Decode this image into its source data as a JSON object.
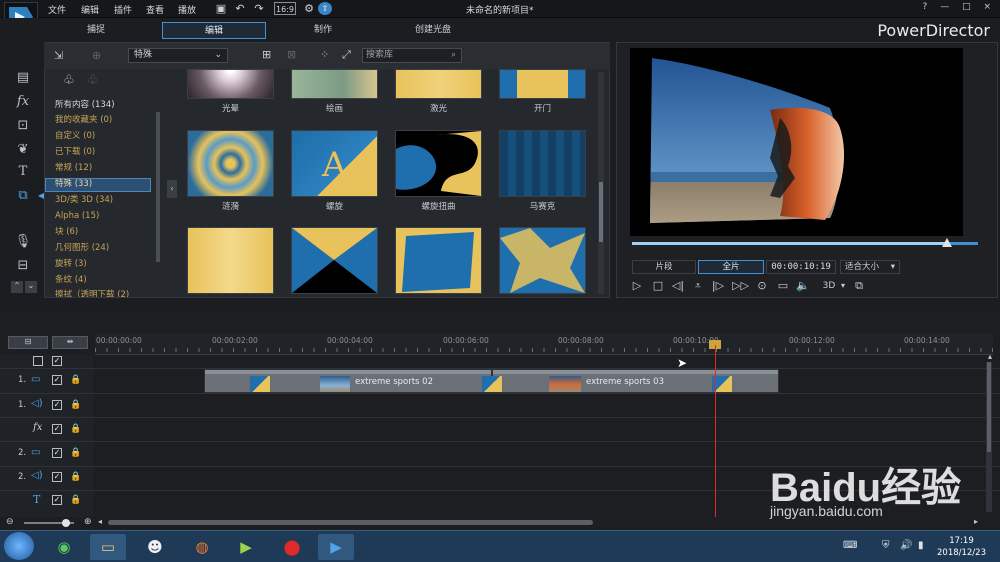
{
  "menu": [
    "文件",
    "编辑",
    "插件",
    "查看",
    "播放"
  ],
  "window_title": "未命名的新项目*",
  "window_buttons": [
    "?",
    "—",
    "□",
    "×"
  ],
  "tabs": [
    {
      "label": "捕捉",
      "active": false
    },
    {
      "label": "编辑",
      "active": true
    },
    {
      "label": "制作",
      "active": false
    },
    {
      "label": "创建光盘",
      "active": false
    }
  ],
  "brand": "PowerDirector",
  "library": {
    "category_dropdown": "特殊",
    "search_placeholder": "搜索库",
    "categories": [
      {
        "label": "所有内容 (134)",
        "selected": false
      },
      {
        "label": "我的收藏夹 (0)",
        "selected": false
      },
      {
        "label": "自定义 (0)",
        "selected": false
      },
      {
        "label": "已下载 (0)",
        "selected": false
      },
      {
        "label": "常规 (12)",
        "selected": false
      },
      {
        "label": "特殊 (33)",
        "selected": true
      },
      {
        "label": "3D/类 3D (34)",
        "selected": false
      },
      {
        "label": "Alpha (15)",
        "selected": false
      },
      {
        "label": "块 (6)",
        "selected": false
      },
      {
        "label": "几何图形 (24)",
        "selected": false
      },
      {
        "label": "旋转 (3)",
        "selected": false
      },
      {
        "label": "条纹 (4)",
        "selected": false
      },
      {
        "label": "擦拭（透明下载 (2)",
        "selected": false
      }
    ],
    "row1_labels": [
      "光晕",
      "绘画",
      "激光",
      "开门"
    ],
    "row2_labels": [
      "涟漪",
      "螺旋",
      "螺旋扭曲",
      "马赛克"
    ]
  },
  "preview": {
    "mode_clip": "片段",
    "mode_movie": "全片",
    "timecode": "00:00:10:19",
    "fit": "适合大小",
    "d3": "3D",
    "progress": 0.91
  },
  "timeline": {
    "ticks": [
      "00:00:00:00",
      "00:00:02:00",
      "00:00:04:00",
      "00:00:06:00",
      "00:00:08:00",
      "00:00:10:00",
      "00:00:12:00",
      "00:00:14:00"
    ],
    "tracks": [
      {
        "num": "1.",
        "type": "video"
      },
      {
        "num": "1.",
        "type": "audio"
      },
      {
        "num": "",
        "type": "fx"
      },
      {
        "num": "2.",
        "type": "video"
      },
      {
        "num": "2.",
        "type": "audio"
      },
      {
        "num": "",
        "type": "title"
      }
    ],
    "clips": [
      "extreme sports 02",
      "extreme sports 03"
    ]
  },
  "taskbar": {
    "time": "17:19",
    "date": "2018/12/23"
  },
  "watermark": {
    "text": "Baidu经验",
    "url": "jingyan.baidu.com"
  }
}
